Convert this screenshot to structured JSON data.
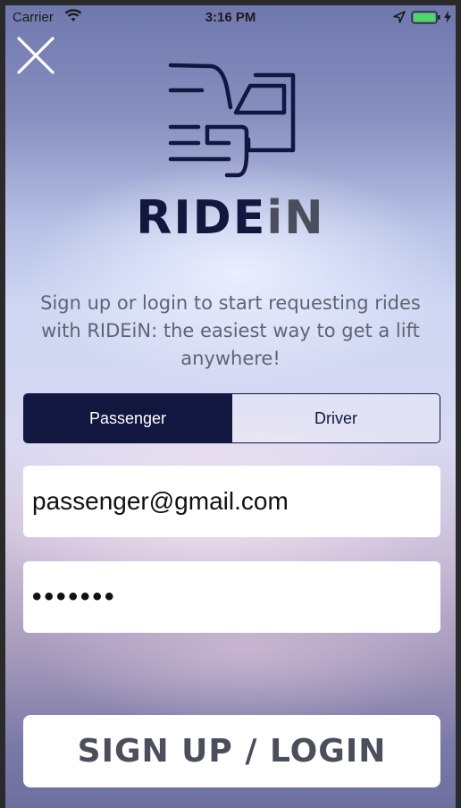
{
  "status_bar": {
    "carrier": "Carrier",
    "time": "3:16 PM",
    "icons": [
      "wifi-icon",
      "location-arrow-icon",
      "battery-icon",
      "charging-bolt-icon"
    ]
  },
  "header": {
    "close_icon": "close-icon",
    "logo_icon": "car-logo-icon",
    "brand_part1": "RIDE",
    "brand_part2": "iN"
  },
  "tagline": "Sign up or login to start requesting rides with RIDEiN: the easiest way to get a lift anywhere!",
  "segmented": {
    "options": [
      "Passenger",
      "Driver"
    ],
    "selected": "Passenger"
  },
  "form": {
    "email_value": "passenger@gmail.com",
    "password_value": "•••••••"
  },
  "submit_label": "SIGN UP / LOGIN",
  "colors": {
    "brand_navy": "#12173f",
    "brand_gray": "#4b4f5c",
    "field_bg": "#ffffff",
    "battery_green": "#4cd964"
  }
}
